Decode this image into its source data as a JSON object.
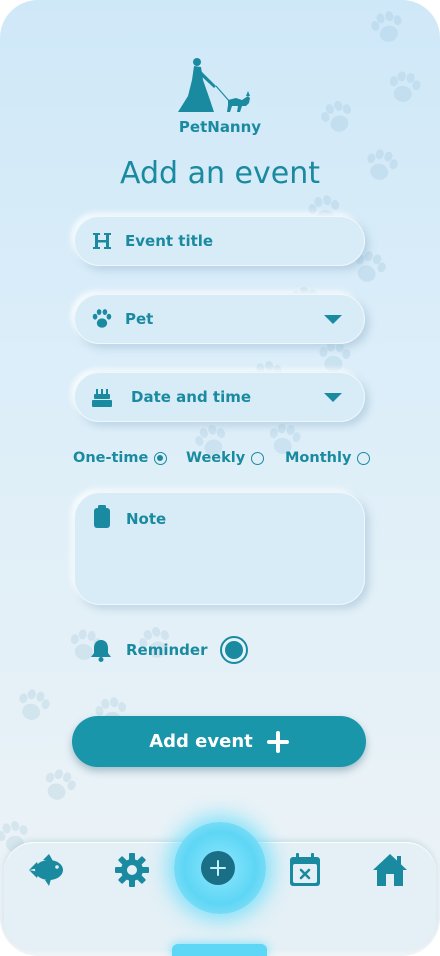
{
  "app": {
    "brand": "PetNanny"
  },
  "page": {
    "title": "Add an event"
  },
  "form": {
    "event_title_placeholder": "Event title",
    "pet_label": "Pet",
    "datetime_label": "Date and time",
    "recurrence": [
      {
        "label": "One-time",
        "selected": true
      },
      {
        "label": "Weekly",
        "selected": false
      },
      {
        "label": "Monthly",
        "selected": false
      }
    ],
    "note_placeholder": "Note",
    "reminder_label": "Reminder",
    "reminder_on": true,
    "submit_label": "Add event"
  },
  "nav": {
    "items": [
      "fish-icon",
      "gear-icon",
      "add-icon",
      "calendar-x-icon",
      "home-icon"
    ]
  },
  "colors": {
    "accent": "#1a8aa0",
    "button": "#1a96ab",
    "glow": "#5ed6f5"
  }
}
